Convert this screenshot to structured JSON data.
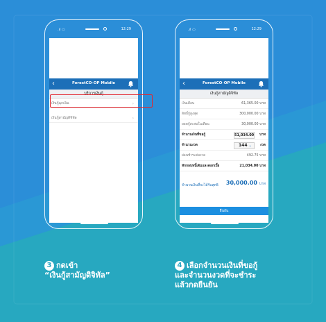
{
  "colors": {
    "brand_blue": "#1c6fb8",
    "highlight_red": "#e2262e",
    "background_light_blue": "#2d8fd6",
    "background_teal": "#27a8c0"
  },
  "status_bar": {
    "time": "12:29",
    "signal": ".ıl ▭"
  },
  "app": {
    "title": "ForestCO-OP Mobile"
  },
  "phone1": {
    "subtitle": "บริการเงินกู้",
    "menu": [
      {
        "label": "เงินกู้ฉุกเฉิน"
      },
      {
        "label": "เงินกู้สามัญดิจิทัล",
        "highlighted": true
      }
    ]
  },
  "phone2": {
    "subtitle": "เงินกู้สามัญดิจิทัล",
    "rows": [
      {
        "label": "เงินเดือน",
        "value": "61,365.00 บาท"
      },
      {
        "label": "สิทธิ์กู้สูงสุด",
        "value": "300,000.00 บาท"
      },
      {
        "label": "ยอดกู้สะสมในเดือน",
        "value": "30,000.00 บาท"
      },
      {
        "label": "จำนวนเงินที่ขอกู้",
        "value": "51,034.00",
        "unit": "บาท"
      },
      {
        "label": "จำนวนงวด",
        "value": "144",
        "unit": "งวด"
      },
      {
        "label": "ผ่อนชำระต่องวด",
        "value": "492.75 บาท"
      },
      {
        "label": "หักกลบหนี้เดิมและดอกเบี้ย",
        "value": "21,034.00 บาท"
      }
    ],
    "total_label": "จำนวนเงินที่จะได้รับสุทธิ",
    "total_value": "30,000.00",
    "total_unit": "บาท",
    "confirm_label": "ยืนยัน"
  },
  "steps": [
    {
      "number": "3",
      "line1": "กดเข้า",
      "line2": "“เงินกู้สามัญดิจิทัล”"
    },
    {
      "number": "4",
      "line1": "เลือกจำนวนเงินที่ขอกู้",
      "line2": "และจำนวนงวดที่จะชำระ",
      "line3": "แล้วกดยืนยัน"
    }
  ]
}
